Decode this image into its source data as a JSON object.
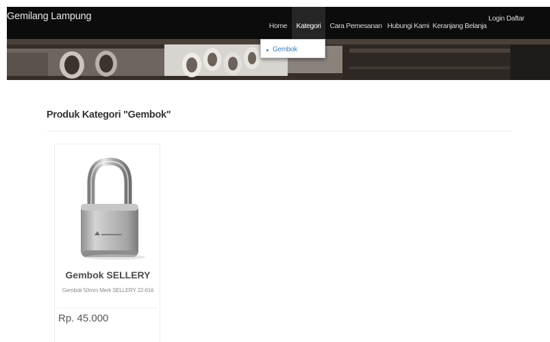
{
  "brand": "Gemilang Lampung",
  "nav": {
    "items": [
      {
        "label": "Home"
      },
      {
        "label": "Kategori"
      },
      {
        "label": "Cara Pemesanan"
      },
      {
        "label": "Hubungi Kami"
      },
      {
        "label": "Keranjang Belanja"
      }
    ],
    "login_label": "Login Daftar"
  },
  "dropdown": {
    "items": [
      {
        "label": "Gembok"
      }
    ]
  },
  "page": {
    "title": "Produk Kategori \"Gembok\""
  },
  "products": [
    {
      "name": "Gembok SELLERY",
      "description": "Gembok 50mm Merk SELLERY 22-616",
      "price": "Rp. 45.000",
      "image_icon": "padlock-icon"
    }
  ],
  "colors": {
    "navbar_bg": "#0c0c0c",
    "nav_active_bg": "#262626",
    "dropdown_link": "#3c7fb8"
  }
}
